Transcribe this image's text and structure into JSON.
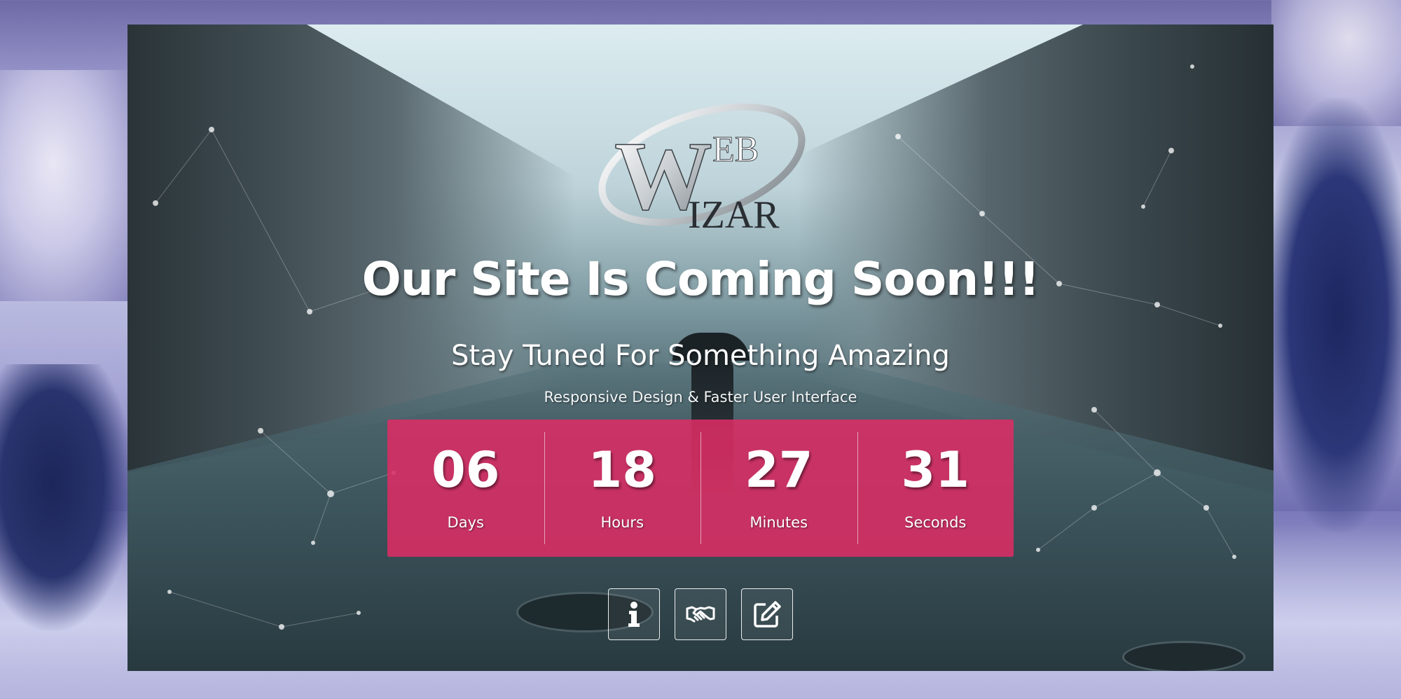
{
  "logo": {
    "letters_top": "EB",
    "letters_bottom": "IZAR",
    "initial_w_top": "W",
    "initial_w_bottom": "W"
  },
  "hero": {
    "headline": "Our Site Is Coming Soon!!!",
    "subheadline": "Stay Tuned For Something Amazing",
    "tagline": "Responsive Design & Faster User Interface"
  },
  "countdown": {
    "accent_color": "#dc2c64",
    "units": [
      {
        "value": "06",
        "label": "Days"
      },
      {
        "value": "18",
        "label": "Hours"
      },
      {
        "value": "27",
        "label": "Minutes"
      },
      {
        "value": "31",
        "label": "Seconds"
      }
    ]
  },
  "actions": [
    {
      "icon": "info-icon"
    },
    {
      "icon": "handshake-icon"
    },
    {
      "icon": "edit-icon"
    }
  ]
}
